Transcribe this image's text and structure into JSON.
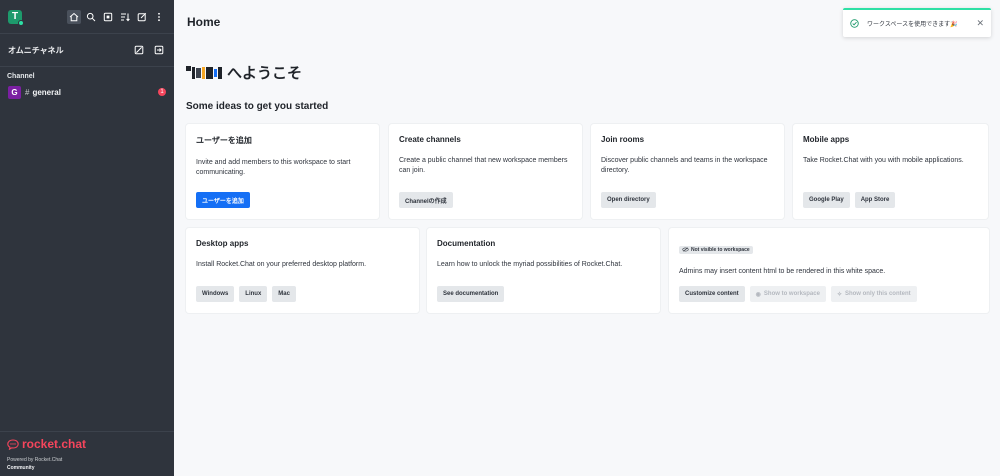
{
  "sidebar": {
    "user_avatar_letter": "T",
    "omnichannel_label": "オムニチャネル",
    "section_label": "Channel",
    "rooms": [
      {
        "avatar_letter": "G",
        "name": "general",
        "unread": "1"
      }
    ],
    "footer": {
      "logo_text": "rocket.chat",
      "powered_by": "Powered by Rocket.Chat",
      "edition": "Community"
    }
  },
  "header": {
    "title": "Home"
  },
  "main": {
    "welcome": "へようこそ",
    "ideas_title": "Some ideas to get you started",
    "cards": {
      "add_users": {
        "title": "ユーザーを追加",
        "desc": "Invite and add members to this workspace to start communicating.",
        "button": "ユーザーを追加"
      },
      "create_channels": {
        "title": "Create channels",
        "desc": "Create a public channel that new workspace members can join.",
        "button": "Channelの作成"
      },
      "join_rooms": {
        "title": "Join rooms",
        "desc": "Discover public channels and teams in the workspace directory.",
        "button": "Open directory"
      },
      "mobile_apps": {
        "title": "Mobile apps",
        "desc": "Take Rocket.Chat with you with mobile applications.",
        "buttons": [
          "Google Play",
          "App Store"
        ]
      },
      "desktop_apps": {
        "title": "Desktop apps",
        "desc": "Install Rocket.Chat on your preferred desktop platform.",
        "buttons": [
          "Windows",
          "Linux",
          "Mac"
        ]
      },
      "documentation": {
        "title": "Documentation",
        "desc": "Learn how to unlock the myriad possibilities of Rocket.Chat.",
        "button": "See documentation"
      },
      "custom_content": {
        "tag": "Not visible to workspace",
        "desc": "Admins may insert content html to be rendered in this white space.",
        "buttons": [
          "Customize content",
          "Show to workspace",
          "Show only this content"
        ]
      }
    }
  },
  "toast": {
    "text": "ワークスペースを使用できます🎉"
  },
  "colors": {
    "brand": "#f5455c",
    "primary": "#156ff5",
    "sidebar": "#2f343d",
    "success": "#2de0a5"
  }
}
